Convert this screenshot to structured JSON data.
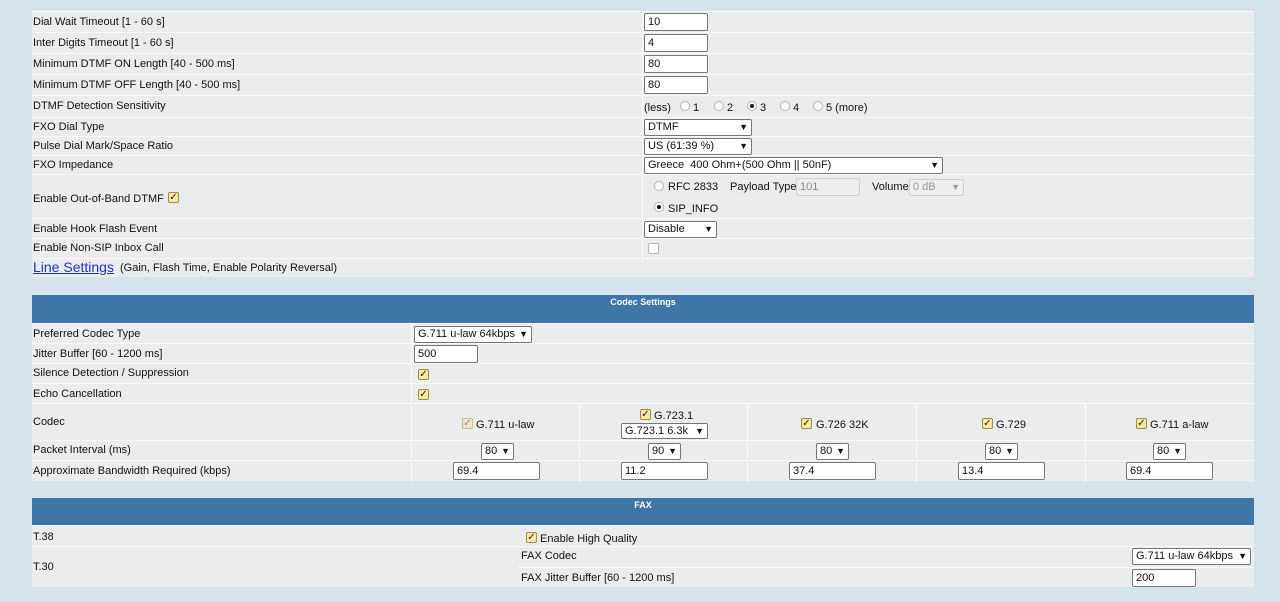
{
  "dtmf": {
    "dial_wait_label": "Dial Wait Timeout [1 - 60 s]",
    "dial_wait_value": "10",
    "inter_digits_label": "Inter Digits Timeout [1 - 60 s]",
    "inter_digits_value": "4",
    "min_on_label": "Minimum DTMF ON Length [40 - 500 ms]",
    "min_on_value": "80",
    "min_off_label": "Minimum DTMF OFF Length [40 - 500 ms]",
    "min_off_value": "80",
    "sensitivity_label": "DTMF Detection Sensitivity",
    "sensitivity_less": "(less)",
    "sensitivity_options": [
      "1",
      "2",
      "3",
      "4",
      "5 (more)"
    ],
    "sensitivity_selected": "3",
    "dial_type_label": "FXO Dial Type",
    "dial_type_value": "DTMF",
    "pulse_ratio_label": "Pulse Dial Mark/Space Ratio",
    "pulse_ratio_value": "US (61:39 %)",
    "impedance_label": "FXO Impedance",
    "impedance_value": "Greece  400 Ohm+(500 Ohm || 50nF)",
    "oob_label": "Enable Out-of-Band DTMF",
    "oob_checked": true,
    "rfc_label": "RFC 2833",
    "payload_label": "Payload Type",
    "payload_value": "101",
    "volume_label": "Volume",
    "volume_value": "0 dB",
    "sip_info_label": "SIP_INFO",
    "method_selected": "SIP_INFO",
    "hook_flash_label": "Enable Hook Flash Event",
    "hook_flash_value": "Disable",
    "non_sip_label": "Enable Non-SIP Inbox Call",
    "non_sip_checked": false,
    "line_settings_link": "Line Settings",
    "line_settings_note": "(Gain, Flash Time, Enable Polarity Reversal)"
  },
  "codec": {
    "title": "Codec Settings",
    "preferred_label": "Preferred Codec Type",
    "preferred_value": "G.711 u-law 64kbps",
    "jitter_label": "Jitter Buffer [60 - 1200 ms]",
    "jitter_value": "500",
    "silence_label": "Silence Detection / Suppression",
    "silence_checked": true,
    "echo_label": "Echo Cancellation",
    "echo_checked": true,
    "codec_label": "Codec",
    "packet_label": "Packet Interval (ms)",
    "bandwidth_label": "Approximate Bandwidth Required (kbps)",
    "columns": [
      {
        "name": "G.711 u-law",
        "checked": true,
        "disabled": true,
        "packet": "80",
        "bandwidth": "69.4"
      },
      {
        "name": "G.723.1",
        "checked": true,
        "disabled": false,
        "sub_select": "G.723.1 6.3k",
        "packet": "90",
        "bandwidth": "11.2"
      },
      {
        "name": "G.726 32K",
        "checked": true,
        "disabled": false,
        "packet": "80",
        "bandwidth": "37.4"
      },
      {
        "name": "G.729",
        "checked": true,
        "disabled": false,
        "packet": "80",
        "bandwidth": "13.4"
      },
      {
        "name": "G.711 a-law",
        "checked": true,
        "disabled": false,
        "packet": "80",
        "bandwidth": "69.4"
      }
    ]
  },
  "fax": {
    "title": "FAX",
    "t38_label": "T.38",
    "high_quality_label": "Enable High Quality",
    "high_quality_checked": true,
    "t30_label": "T.30",
    "fax_codec_label": "FAX Codec",
    "fax_codec_value": "G.711 u-law 64kbps",
    "fax_jitter_label": "FAX Jitter Buffer [60 - 1200 ms]",
    "fax_jitter_value": "200"
  },
  "icons": {
    "dropdown": "chevron-down-icon",
    "checkbox": "checkmark-icon",
    "radio": "radio-dot-icon"
  }
}
